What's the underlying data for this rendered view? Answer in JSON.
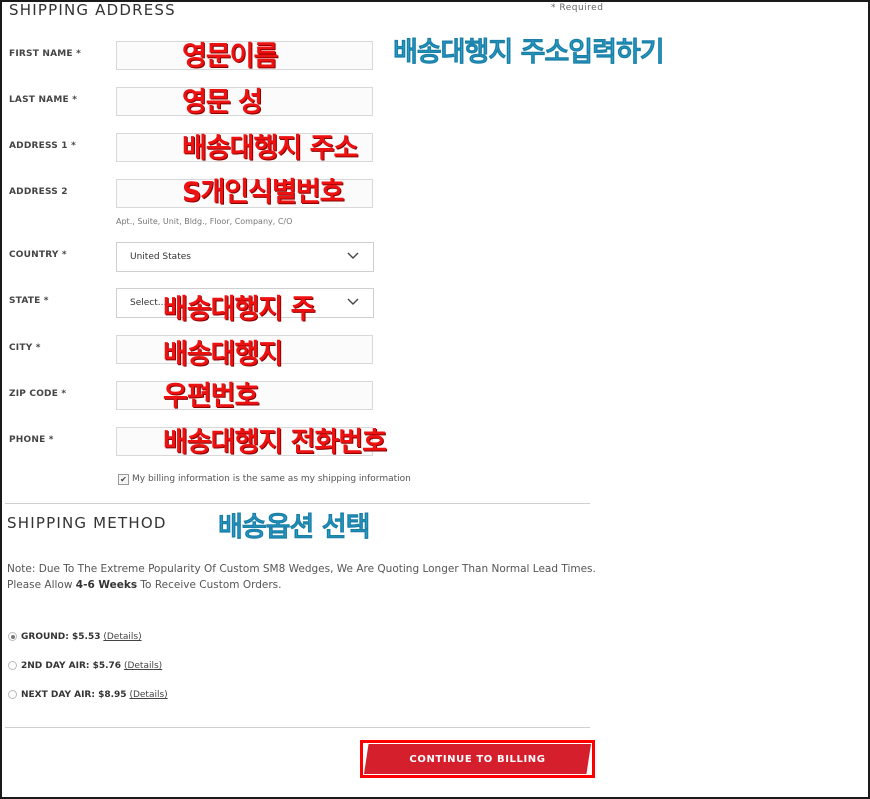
{
  "shipping_address": {
    "title": "SHIPPING ADDRESS",
    "required_note": "* Required",
    "fields": {
      "first_name": "FIRST NAME *",
      "last_name": "LAST NAME *",
      "address1": "ADDRESS 1 *",
      "address2": "ADDRESS 2",
      "address2_hint": "Apt., Suite, Unit, Bldg., Floor, Company, C/O",
      "country": "COUNTRY *",
      "country_value": "United States",
      "state": "STATE *",
      "state_value": "Select...",
      "city": "CITY *",
      "zip": "ZIP CODE *",
      "phone": "PHONE *"
    },
    "billing_same_label": "My billing information is the same as my shipping information",
    "billing_same_checked": true
  },
  "annotations": {
    "address_heading": "배송대행지 주소입력하기",
    "first_name": "영문이름",
    "last_name": "영문 성",
    "address1": "배송대행지 주소",
    "address2": "S개인식별번호",
    "state": "배송대행지 주",
    "city": "배송대행지",
    "zip": "우편번호",
    "phone": "배송대행지 전화번호",
    "method_heading": "배송옵션 선택"
  },
  "shipping_method": {
    "title": "SHIPPING METHOD",
    "note_line1": "Note: Due To The Extreme Popularity Of Custom SM8 Wedges, We Are Quoting Longer Than Normal Lead Times.",
    "note_line2_pre": "Please Allow ",
    "note_line2_bold": "4-6 Weeks",
    "note_line2_post": " To Receive Custom Orders.",
    "options": [
      {
        "label": "GROUND: $5.53",
        "details": "(Details)",
        "selected": true
      },
      {
        "label": "2ND DAY AIR: $5.76",
        "details": "(Details)",
        "selected": false
      },
      {
        "label": "NEXT DAY AIR: $8.95",
        "details": "(Details)",
        "selected": false
      }
    ]
  },
  "continue_button": "CONTINUE TO BILLING",
  "colors": {
    "accent": "#d61f2c",
    "annotation_red": "#ee1111",
    "annotation_blue": "#29a8d6",
    "highlight_box": "#ff0000"
  }
}
